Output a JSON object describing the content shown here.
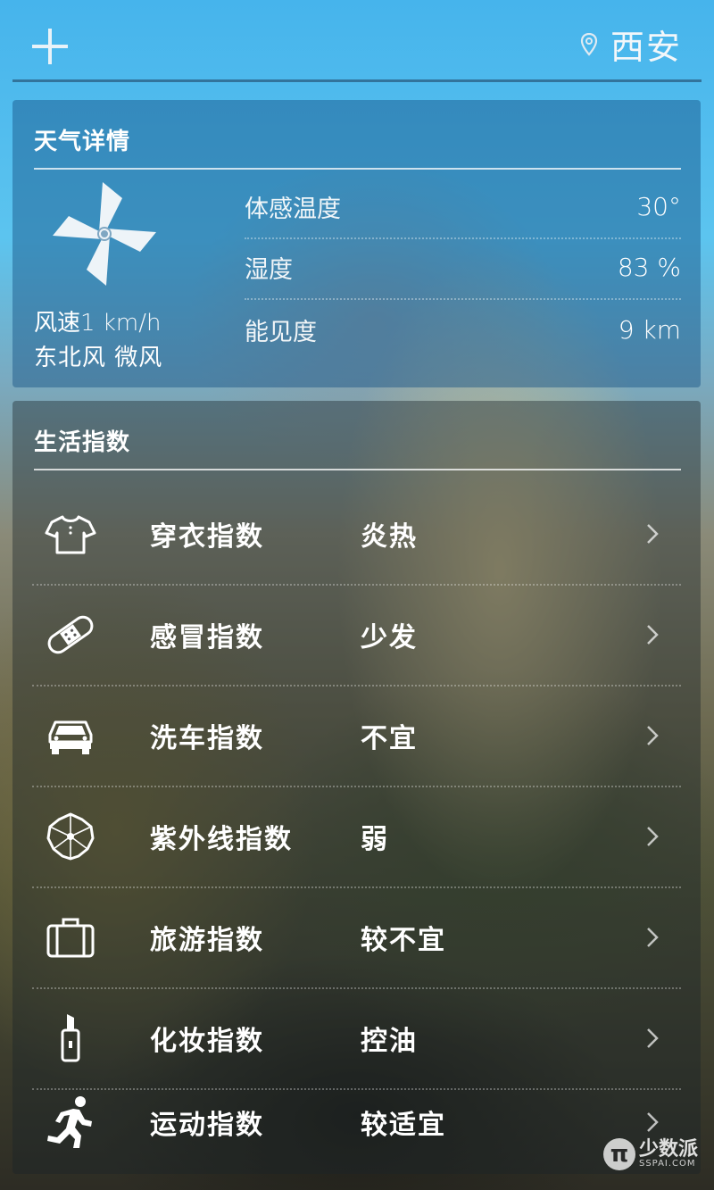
{
  "header": {
    "add_icon": "plus-icon",
    "location_icon": "map-pin-icon",
    "city": "西安"
  },
  "weather_details": {
    "title": "天气详情",
    "fan_icon": "pinwheel-icon",
    "wind_speed_label": "风速",
    "wind_speed_value": "1 km/h",
    "wind_direction": "东北风 微风",
    "rows": [
      {
        "label": "体感温度",
        "value": "30°"
      },
      {
        "label": "湿度",
        "value": "83 %"
      },
      {
        "label": "能见度",
        "value": "9 km"
      }
    ]
  },
  "life_index": {
    "title": "生活指数",
    "items": [
      {
        "icon": "tshirt-icon",
        "name": "穿衣指数",
        "value": "炎热"
      },
      {
        "icon": "bandage-icon",
        "name": "感冒指数",
        "value": "少发"
      },
      {
        "icon": "car-icon",
        "name": "洗车指数",
        "value": "不宜"
      },
      {
        "icon": "umbrella-icon",
        "name": "紫外线指数",
        "value": "弱"
      },
      {
        "icon": "suitcase-icon",
        "name": "旅游指数",
        "value": "较不宜"
      },
      {
        "icon": "lipstick-icon",
        "name": "化妆指数",
        "value": "控油"
      },
      {
        "icon": "running-icon",
        "name": "运动指数",
        "value": "较适宜"
      }
    ]
  },
  "watermark": {
    "cn": "少数派",
    "en": "SSPAI.COM",
    "logo": "π"
  },
  "colors": {
    "sky": "#46b4ec",
    "text": "#ffffff"
  }
}
